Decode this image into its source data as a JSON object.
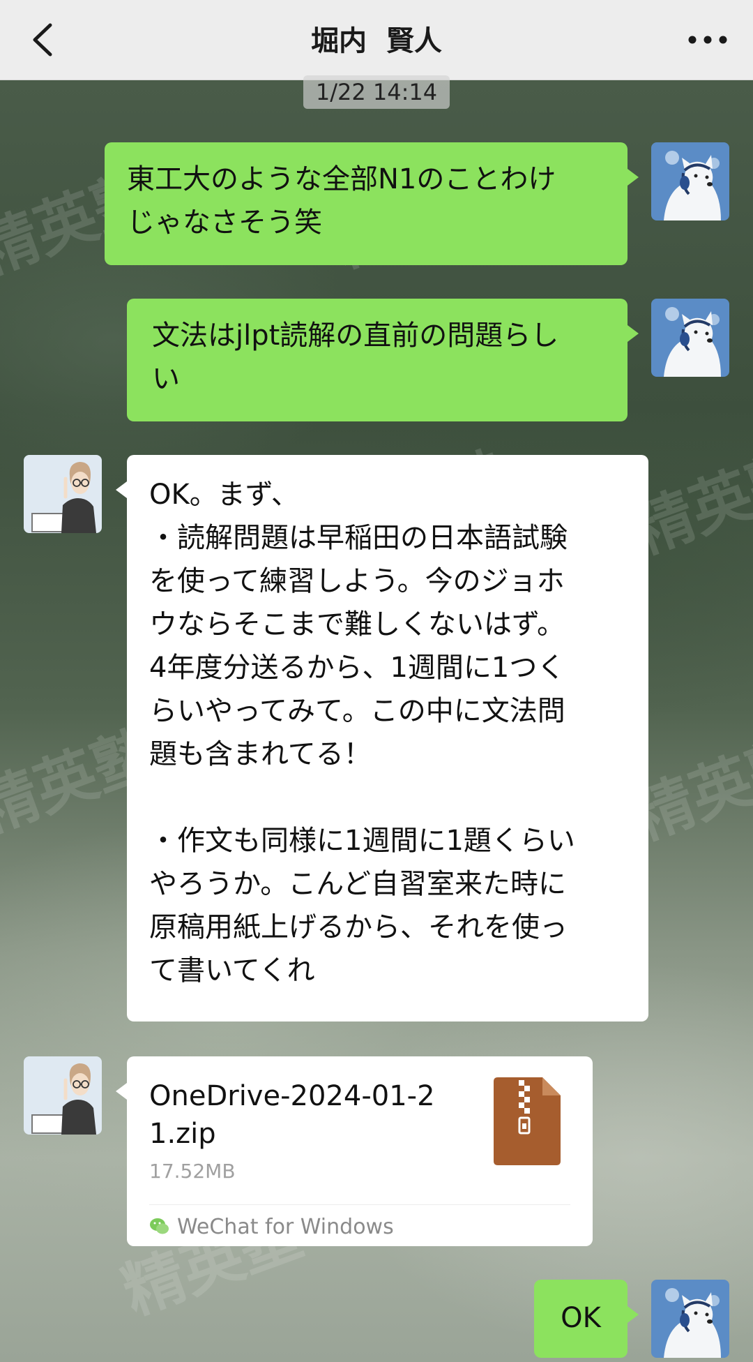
{
  "header": {
    "title": "堀内  賢人",
    "back_icon": "chevron-left-icon",
    "more_icon": "more-dots-icon"
  },
  "watermark": "精英塾",
  "timestamp": "1/22 14:14",
  "messages": [
    {
      "side": "right",
      "lines": [
        "東工大のような全部N1のことわけ",
        "じゃなさそう笑"
      ]
    },
    {
      "side": "right",
      "lines": [
        "文法はjlpt読解の直前の問題らし",
        "い"
      ]
    },
    {
      "side": "left",
      "lines": [
        "OK。まず、",
        "・読解問題は早稲田の日本語試験",
        "を使って練習しよう。今のジョホ",
        "ウならそこまで難しくないはず。",
        "4年度分送るから、1週間に1つく",
        "らいやってみて。この中に文法問",
        "題も含まれてる！",
        "",
        "・作文も同様に1週間に1題くらい",
        "やろうか。こんど自習室来た時に",
        "原稿用紙上げるから、それを使っ",
        "て書いてくれ"
      ]
    },
    {
      "side": "right",
      "lines": [
        "OK"
      ]
    }
  ],
  "file": {
    "name_lines": [
      "OneDrive-2024-01-2",
      "1.zip"
    ],
    "size": "17.52MB",
    "source": "WeChat for Windows",
    "icon": "zip-file-icon",
    "icon_color": "#a65d2e"
  },
  "colors": {
    "sent_bubble": "#8ce25e",
    "received_bubble": "#ffffff",
    "header_bg": "#ededed"
  }
}
